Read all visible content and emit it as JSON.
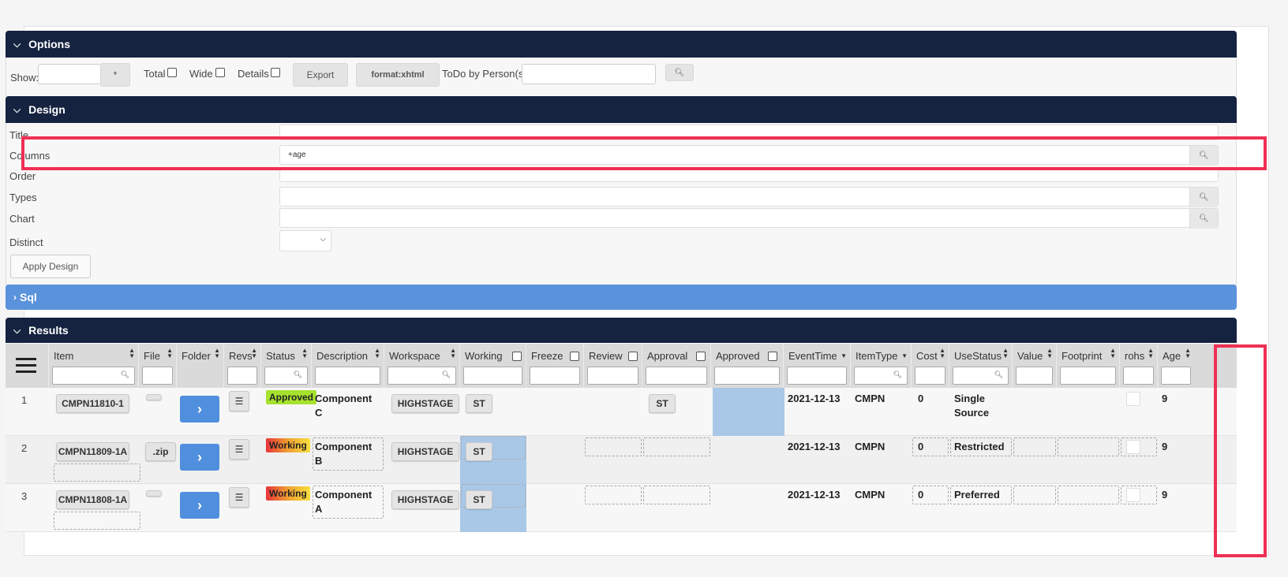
{
  "options": {
    "title": "Options",
    "show_label": "Show:",
    "show_value": "",
    "star_button": "*",
    "total_label": "Total",
    "wide_label": "Wide",
    "details_label": "Details",
    "export_button": "Export",
    "format_button": "format:xhtml",
    "todo_label": "ToDo by Person(s)",
    "todo_value": ""
  },
  "design": {
    "title": "Design",
    "rows": [
      {
        "label": "Title",
        "value": ""
      },
      {
        "label": "Columns",
        "value": "+age"
      },
      {
        "label": "Order",
        "value": ""
      },
      {
        "label": "Types",
        "value": ""
      },
      {
        "label": "Chart",
        "value": ""
      },
      {
        "label": "Distinct",
        "value": ""
      }
    ],
    "apply_button": "Apply Design"
  },
  "sql": {
    "title": "Sql"
  },
  "results": {
    "title": "Results",
    "columns": [
      "Item",
      "File",
      "Folder",
      "Revs",
      "Status",
      "Description",
      "Workspace",
      "Working",
      "Freeze",
      "Review",
      "Approval",
      "Approved",
      "EventTime",
      "ItemType",
      "Cost",
      "UseStatus",
      "Value",
      "Footprint",
      "rohs",
      "Age"
    ],
    "rows": [
      {
        "num": "1",
        "item": "CMPN11810-1",
        "file": "",
        "status": "Approved",
        "description": [
          "Component",
          "C"
        ],
        "workspace": "HIGHSTAGE",
        "working": "ST",
        "approval": "ST",
        "eventtime": "2021-12-13",
        "itemtype": "CMPN",
        "cost": "0",
        "usestatus": [
          "Single",
          "Source"
        ],
        "age": "9"
      },
      {
        "num": "2",
        "item": "CMPN11809-1A",
        "file": ".zip",
        "status": "Working",
        "description": [
          "Component",
          "B"
        ],
        "workspace": "HIGHSTAGE",
        "working": "ST",
        "approval": "",
        "eventtime": "2021-12-13",
        "itemtype": "CMPN",
        "cost": "0",
        "usestatus": [
          "Restricted"
        ],
        "age": "9"
      },
      {
        "num": "3",
        "item": "CMPN11808-1A",
        "file": "",
        "status": "Working",
        "description": [
          "Component",
          "A"
        ],
        "workspace": "HIGHSTAGE",
        "working": "ST",
        "approval": "",
        "eventtime": "2021-12-13",
        "itemtype": "CMPN",
        "cost": "0",
        "usestatus": [
          "Preferred"
        ],
        "age": "9"
      }
    ]
  },
  "colors": {
    "header_bar": "#152240",
    "sql_bar": "#5a92dc",
    "highlight": "#ef3054",
    "approved_badge": "#a6e22e",
    "link_button": "#4f8fde"
  }
}
